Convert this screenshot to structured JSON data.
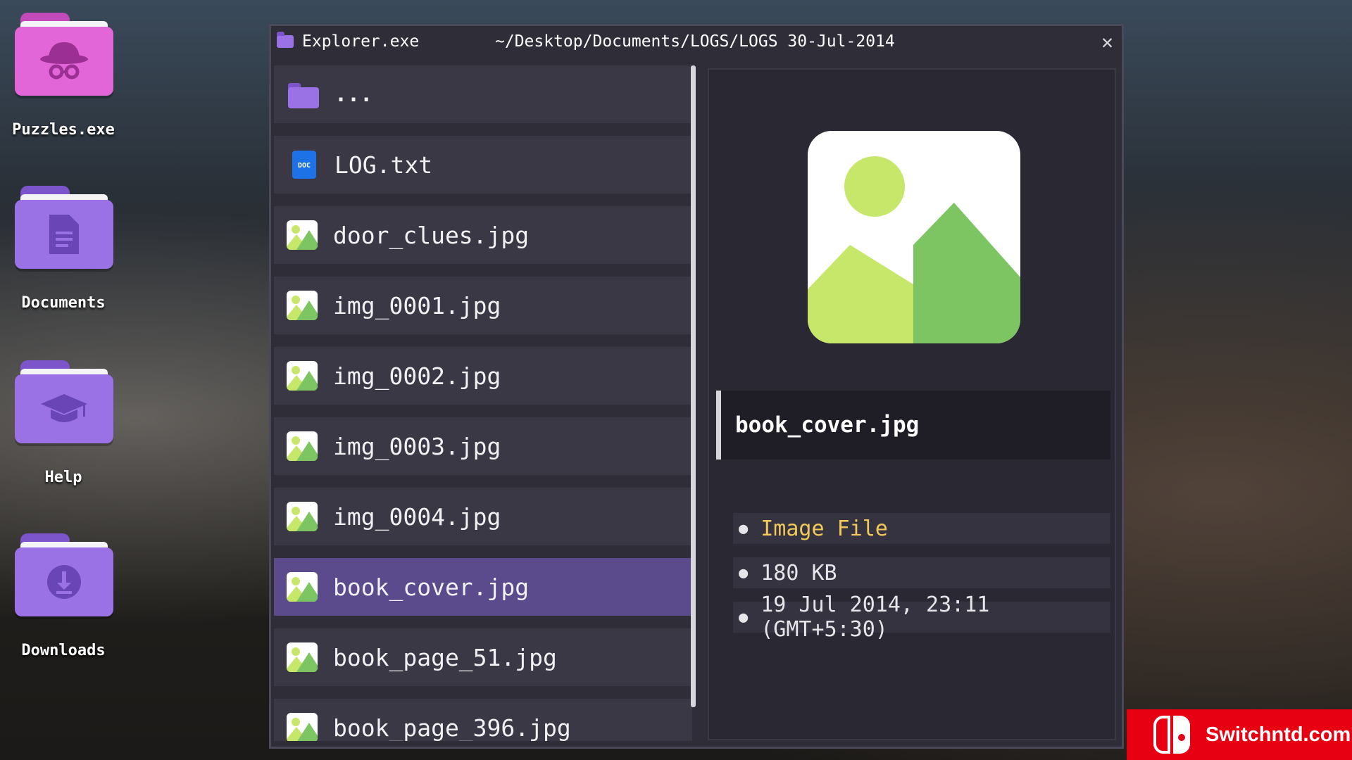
{
  "desktop": {
    "icons": [
      {
        "label": "Puzzles.exe",
        "icon": "spy-hat-icon"
      },
      {
        "label": "Documents",
        "icon": "document-icon"
      },
      {
        "label": "Help",
        "icon": "graduation-cap-icon"
      },
      {
        "label": "Downloads",
        "icon": "download-icon"
      }
    ]
  },
  "window": {
    "app_name": "Explorer.exe",
    "path": "~/Desktop/Documents/LOGS/LOGS 30-Jul-2014",
    "close_icon": "close-icon"
  },
  "file_list": {
    "items": [
      {
        "name": "...",
        "icon": "folder-icon"
      },
      {
        "name": "LOG.txt",
        "icon": "doc-file-icon"
      },
      {
        "name": "door_clues.jpg",
        "icon": "image-file-icon"
      },
      {
        "name": "img_0001.jpg",
        "icon": "image-file-icon"
      },
      {
        "name": "img_0002.jpg",
        "icon": "image-file-icon"
      },
      {
        "name": "img_0003.jpg",
        "icon": "image-file-icon"
      },
      {
        "name": "img_0004.jpg",
        "icon": "image-file-icon"
      },
      {
        "name": "book_cover.jpg",
        "icon": "image-file-icon",
        "selected": true
      },
      {
        "name": "book_page_51.jpg",
        "icon": "image-file-icon"
      },
      {
        "name": "book_page_396.jpg",
        "icon": "image-file-icon"
      }
    ],
    "doc_badge": "DOC"
  },
  "preview": {
    "file_name": "book_cover.jpg",
    "type": "Image File",
    "size": "180 KB",
    "modified": "19 Jul 2014, 23:11 (GMT+5:30)",
    "image_icon": "image-preview-icon"
  },
  "watermark": {
    "text": "Switchntd.com"
  },
  "colors": {
    "selected_row": "#5b4a8c",
    "type_accent": "#f3c85a",
    "folder_purple": "#9a72e6",
    "folder_pink": "#e266d8"
  }
}
